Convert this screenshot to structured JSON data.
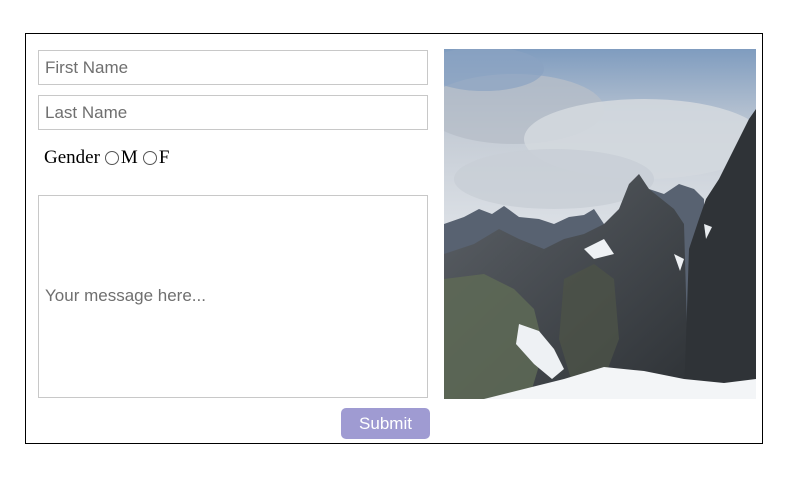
{
  "form": {
    "first_name_placeholder": "First Name",
    "last_name_placeholder": "Last Name",
    "gender_label": "Gender",
    "gender_options": [
      "M",
      "F"
    ],
    "message_placeholder": "Your message here...",
    "submit_label": "Submit"
  },
  "colors": {
    "submit_button": "#9f9bd2",
    "field_border": "#c8c8c8",
    "frame_border": "#000000"
  },
  "image": {
    "subject": "mountain landscape with snow under cloudy sky"
  }
}
